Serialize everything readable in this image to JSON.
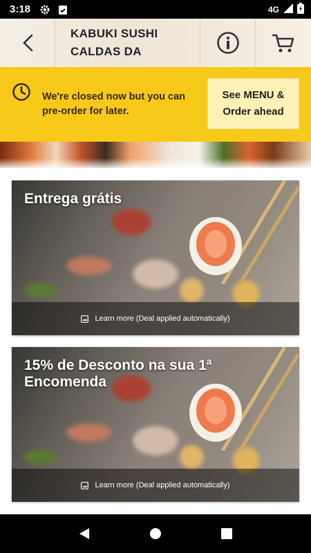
{
  "status_bar": {
    "time": "3:18",
    "network": "4G"
  },
  "header": {
    "title": "KABUKI SUSHI CALDAS DA",
    "back_icon": "chevron-left-icon",
    "info_icon": "info-circle-icon",
    "cart_icon": "cart-icon"
  },
  "closed_banner": {
    "message": "We're closed now but you can pre-order for later.",
    "button_label": "See MENU & Order ahead",
    "bg_color": "#f7c91a",
    "button_bg": "#fdf1b7"
  },
  "deals": [
    {
      "title": "Entrega grátis",
      "footer": "Learn more (Deal applied automatically)"
    },
    {
      "title": "15% de Desconto na sua 1ª Encomenda",
      "footer": "Learn more (Deal applied automatically)"
    }
  ]
}
